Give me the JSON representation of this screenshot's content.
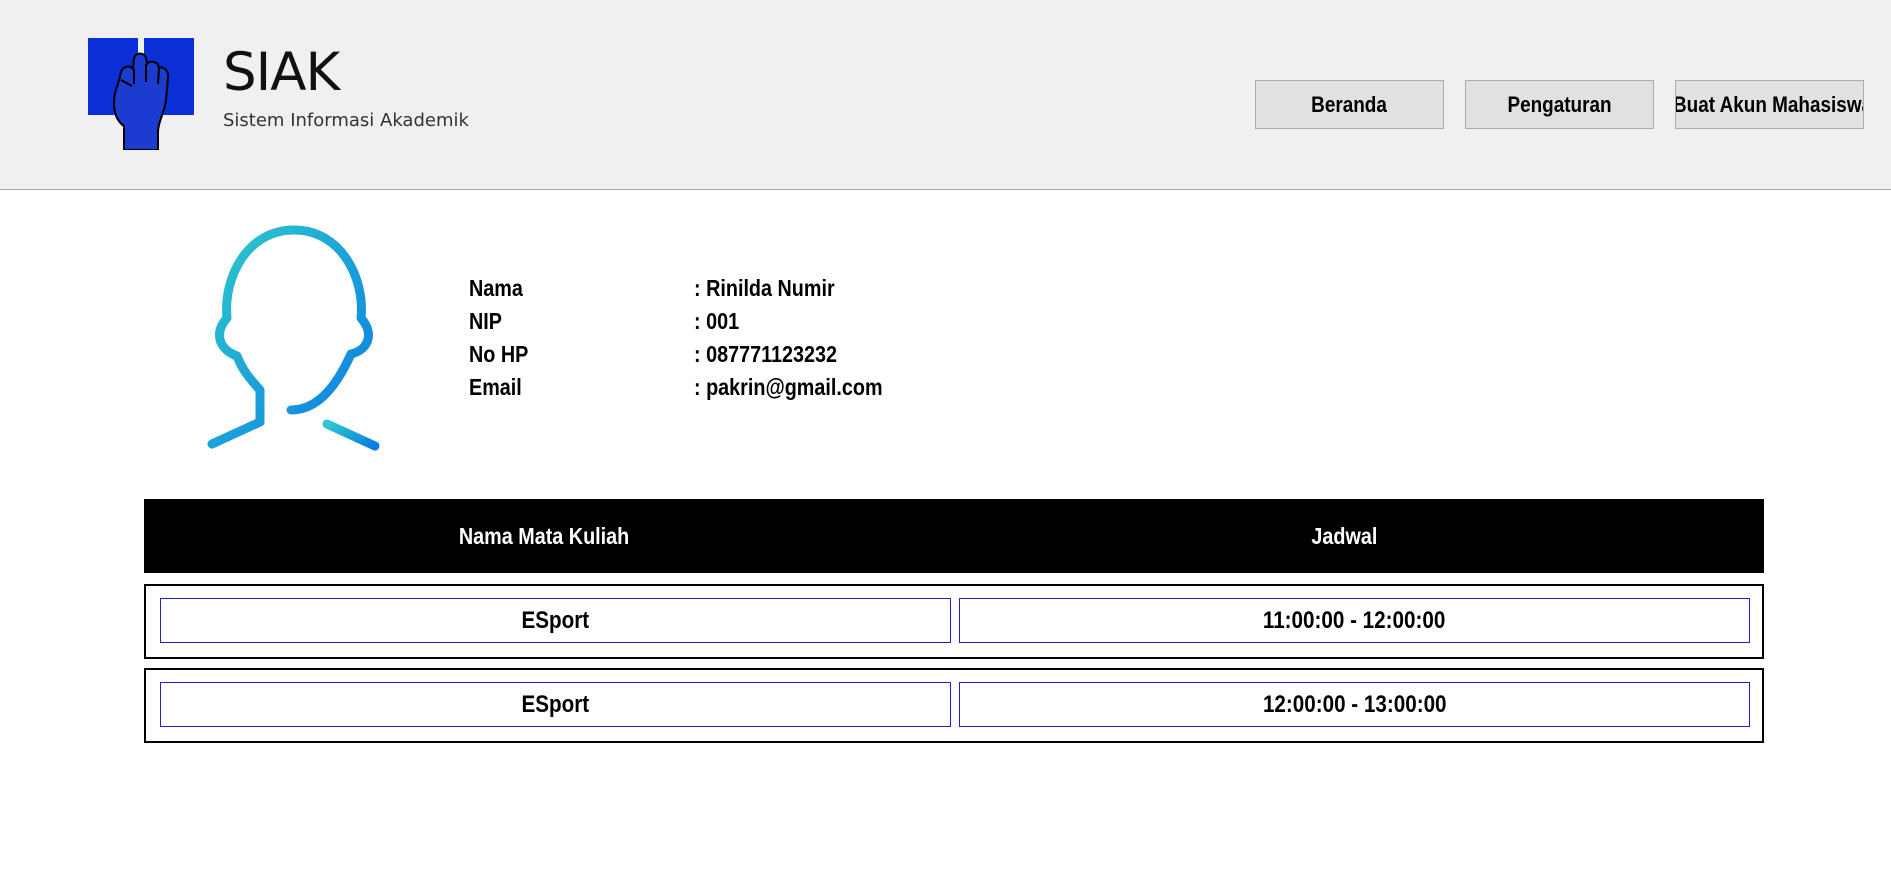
{
  "app": {
    "title": "SIAK",
    "subtitle": "Sistem Informasi Akademik",
    "logo_icon": "raised-fist-book-icon",
    "brand_color": "#0a2fd6"
  },
  "nav": {
    "beranda": "Beranda",
    "pengaturan": "Pengaturan",
    "buat_akun": "Buat Akun Mahasiswa"
  },
  "profile": {
    "avatar_icon": "user-avatar-icon",
    "fields": [
      {
        "label": "Nama",
        "value": ": Rinilda Numir"
      },
      {
        "label": "NIP",
        "value": ": 001"
      },
      {
        "label": "No HP",
        "value": ": 087771123232"
      },
      {
        "label": "Email",
        "value": ": pakrin@gmail.com"
      }
    ]
  },
  "table": {
    "headers": {
      "course": "Nama Mata Kuliah",
      "schedule": "Jadwal"
    },
    "rows": [
      {
        "course": "ESport",
        "schedule": "11:00:00 - 12:00:00"
      },
      {
        "course": "ESport",
        "schedule": "12:00:00 - 13:00:00"
      }
    ]
  }
}
